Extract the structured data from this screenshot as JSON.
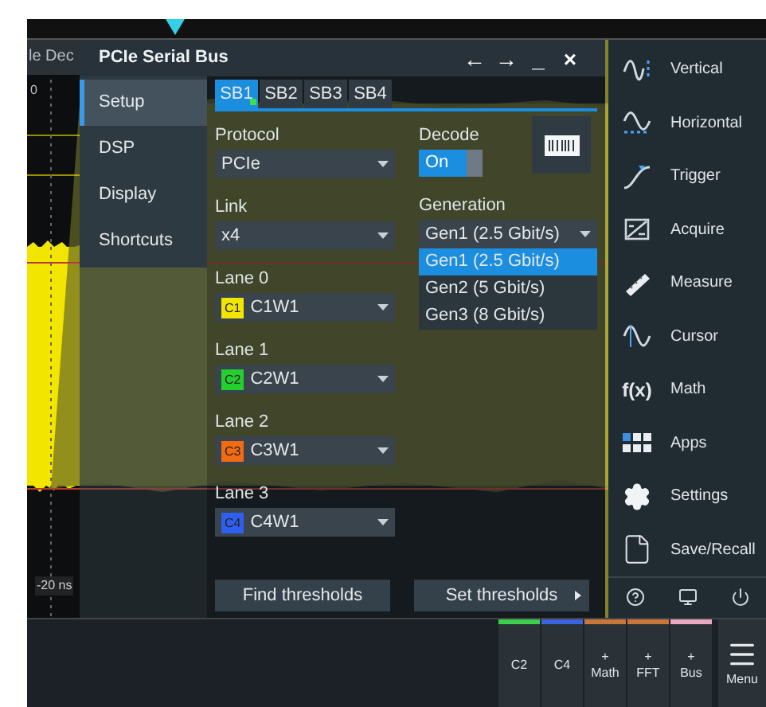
{
  "background": {
    "tab_label": "le Dec",
    "offset_label": "0",
    "time_label": "-20 ns"
  },
  "dialog": {
    "title": "PCIe Serial Bus",
    "title_buttons": [
      "←",
      "→",
      "_",
      "×"
    ]
  },
  "sidebar": [
    {
      "label": "Setup",
      "selected": true
    },
    {
      "label": "DSP",
      "selected": false
    },
    {
      "label": "Display",
      "selected": false
    },
    {
      "label": "Shortcuts",
      "selected": false
    }
  ],
  "tabs": [
    {
      "label": "SB1",
      "selected": true,
      "enabled": true
    },
    {
      "label": "SB2",
      "selected": false,
      "enabled": false
    },
    {
      "label": "SB3",
      "selected": false,
      "enabled": false
    },
    {
      "label": "SB4",
      "selected": false,
      "enabled": false
    }
  ],
  "protocol": {
    "label": "Protocol",
    "value": "PCIe"
  },
  "decode": {
    "label": "Decode",
    "value": "On",
    "on": true
  },
  "link": {
    "label": "Link",
    "value": "x4"
  },
  "generation": {
    "label": "Generation",
    "value": "Gen1 (2.5 Gbit/s)",
    "expanded": true,
    "options": [
      {
        "label": "Gen1 (2.5 Gbit/s)",
        "selected": true
      },
      {
        "label": "Gen2 (5 Gbit/s)",
        "selected": false
      },
      {
        "label": "Gen3 (8 Gbit/s)",
        "selected": false
      }
    ]
  },
  "lanes": [
    {
      "label": "Lane 0",
      "channel": "C1",
      "value": "C1W1",
      "color": "#f2e600"
    },
    {
      "label": "Lane 1",
      "channel": "C2",
      "value": "C2W1",
      "color": "#22d12e"
    },
    {
      "label": "Lane 2",
      "channel": "C3",
      "value": "C3W1",
      "color": "#f26b12"
    },
    {
      "label": "Lane 3",
      "channel": "C4",
      "value": "C4W1",
      "color": "#2f5ff0"
    }
  ],
  "buttons": [
    {
      "label": "Find thresholds",
      "submenu": false
    },
    {
      "label": "Set thresholds",
      "submenu": true
    }
  ],
  "menu": [
    {
      "label": "Vertical",
      "kind": "vertical"
    },
    {
      "label": "Horizontal",
      "kind": "horizontal"
    },
    {
      "label": "Trigger",
      "kind": "trigger"
    },
    {
      "label": "Acquire",
      "kind": "acquire"
    },
    {
      "label": "Measure",
      "kind": "measure"
    },
    {
      "label": "Cursor",
      "kind": "cursor"
    },
    {
      "label": "Math",
      "kind": "text",
      "icon_text": "f(x)"
    },
    {
      "label": "Apps",
      "kind": "apps"
    },
    {
      "label": "Settings",
      "kind": "settings"
    },
    {
      "label": "Save/Recall",
      "kind": "file"
    }
  ],
  "bottom_bar": {
    "buttons": [
      {
        "label": "C2",
        "plus": false,
        "color": "#3ccf4e"
      },
      {
        "label": "C4",
        "plus": false,
        "color": "#3c63e0"
      },
      {
        "label": "Math",
        "plus": true,
        "color": "#c9763a"
      },
      {
        "label": "FFT",
        "plus": true,
        "color": "#c9763a"
      },
      {
        "label": "Bus",
        "plus": true,
        "color": "#e8a8c0"
      }
    ],
    "plus_sign": "+",
    "menu_label": "Menu"
  }
}
